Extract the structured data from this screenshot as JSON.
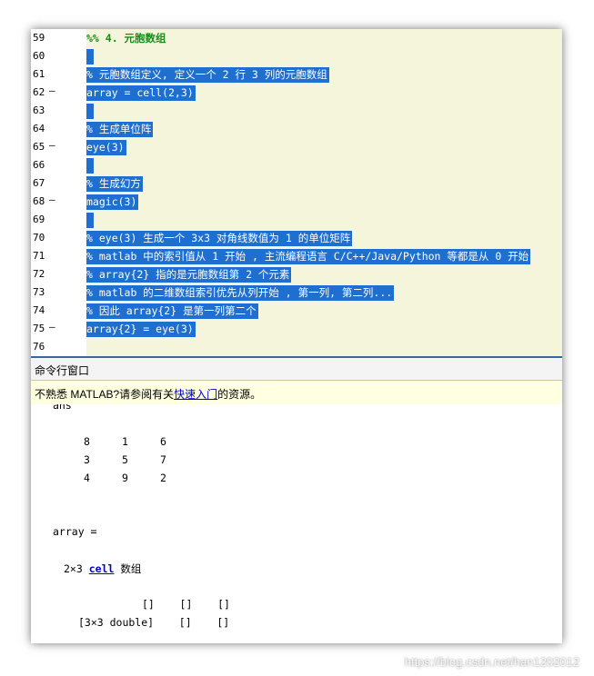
{
  "editor": {
    "lines": [
      {
        "num": "59",
        "dash": "",
        "text": "%% 4. 元胞数组",
        "style": "plain"
      },
      {
        "num": "60",
        "dash": "",
        "text": "",
        "style": "sel"
      },
      {
        "num": "61",
        "dash": "",
        "text": "% 元胞数组定义, 定义一个 2 行 3 列的元胞数组",
        "style": "sel"
      },
      {
        "num": "62",
        "dash": "–",
        "text": "array = cell(2,3)",
        "style": "sel"
      },
      {
        "num": "63",
        "dash": "",
        "text": "",
        "style": "sel"
      },
      {
        "num": "64",
        "dash": "",
        "text": "% 生成单位阵",
        "style": "sel"
      },
      {
        "num": "65",
        "dash": "–",
        "text": "eye(3)",
        "style": "sel"
      },
      {
        "num": "66",
        "dash": "",
        "text": "",
        "style": "sel"
      },
      {
        "num": "67",
        "dash": "",
        "text": "% 生成幻方",
        "style": "sel"
      },
      {
        "num": "68",
        "dash": "–",
        "text": "magic(3)",
        "style": "sel"
      },
      {
        "num": "69",
        "dash": "",
        "text": "",
        "style": "sel"
      },
      {
        "num": "70",
        "dash": "",
        "text": "% eye(3) 生成一个 3x3 对角线数值为 1 的单位矩阵",
        "style": "sel"
      },
      {
        "num": "71",
        "dash": "",
        "text": "% matlab 中的索引值从 1 开始 , 主流编程语言 C/C++/Java/Python 等都是从 0 开始",
        "style": "sel"
      },
      {
        "num": "72",
        "dash": "",
        "text": "% array{2} 指的是元胞数组第 2 个元素",
        "style": "sel"
      },
      {
        "num": "73",
        "dash": "",
        "text": "% matlab 的二维数组索引优先从列开始 , 第一列, 第二列...",
        "style": "sel"
      },
      {
        "num": "74",
        "dash": "",
        "text": "% 因此 array{2} 是第一列第二个",
        "style": "sel"
      },
      {
        "num": "75",
        "dash": "–",
        "text": "array{2} = eye(3)",
        "style": "sel"
      },
      {
        "num": "76",
        "dash": "",
        "text": "",
        "style": "none"
      }
    ]
  },
  "command_window": {
    "title": "命令行窗口",
    "notice_prefix": "不熟悉 MATLAB?请参阅有关",
    "notice_link": "快速入门",
    "notice_suffix": "的资源。",
    "ans_label": "ans",
    "magic_rows": [
      [
        "8",
        "1",
        "6"
      ],
      [
        "3",
        "5",
        "7"
      ],
      [
        "4",
        "9",
        "2"
      ]
    ],
    "array_label": "array =",
    "size_text": "2×3",
    "cell_link": "cell",
    "cell_suffix": "数组",
    "cell_row1": "[]    []    []",
    "cell_row2": "[3×3 double]    []    []"
  },
  "watermark": "https://blog.csdn.net/han1202012"
}
